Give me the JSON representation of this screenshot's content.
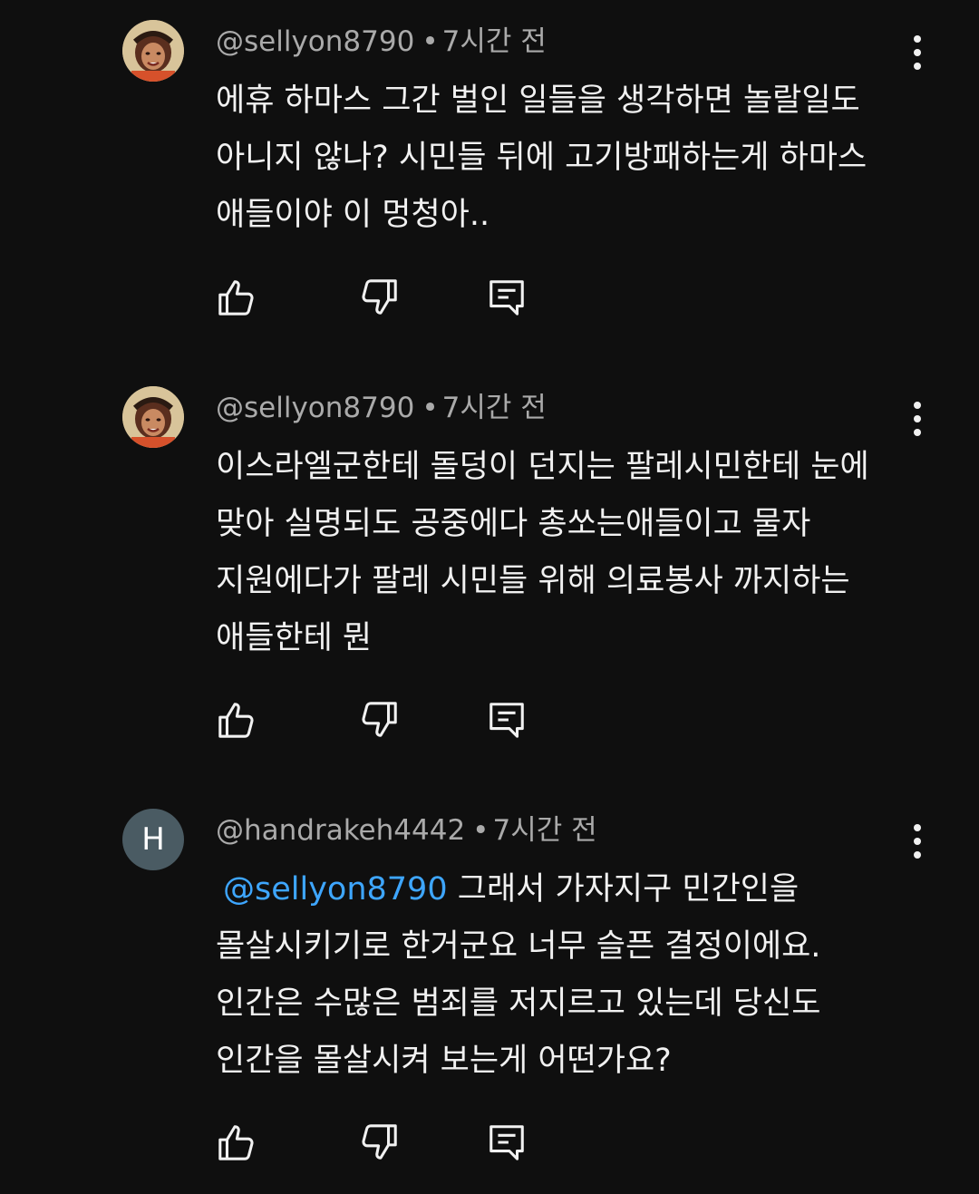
{
  "comments": [
    {
      "handle": "@sellyon8790",
      "time": "7시간 전",
      "lines": [
        "에휴 하마스 그간 벌인 일들을 생각하면 놀랄일도",
        "아니지 않나? 시민들 뒤에 고기방패하는게 하마스",
        "애들이야 이 멍청아.."
      ],
      "avatar_icon": "profile-photo"
    },
    {
      "handle": "@sellyon8790",
      "time": "7시간 전",
      "lines": [
        "이스라엘군한테 돌덩이 던지는 팔레시민한테 눈에",
        "맞아 실명되도 공중에다 총쏘는애들이고 물자",
        "지원에다가 팔레 시민들 위해 의료봉사 까지하는",
        "애들한테 뭔"
      ],
      "avatar_icon": "profile-photo"
    },
    {
      "handle": "@handrakeh4442",
      "time": "7시간 전",
      "avatar_letter": "H",
      "mention": "@sellyon8790",
      "first_line_rest": "그래서 가자지구 민간인을",
      "lines": [
        "몰살시키기로 한거군요 너무 슬픈 결정이에요.",
        "인간은 수많은 범죄를 저지르고 있는데 당신도",
        "인간을 몰살시켜 보는게 어떤가요?"
      ]
    }
  ],
  "separator": "•",
  "icons": {
    "like": "thumbs-up-icon",
    "dislike": "thumbs-down-icon",
    "reply": "reply-comment-icon",
    "menu": "more-vertical-icon"
  },
  "colors": {
    "background": "#0f0f0f",
    "text": "#f1f1f1",
    "meta": "#aaaaaa",
    "mention": "#3ea6ff",
    "avatar_letter_bg": "#4a5b63"
  }
}
